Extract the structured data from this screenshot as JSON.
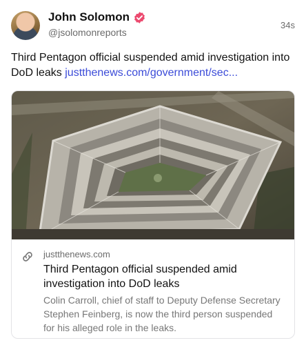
{
  "author": {
    "name": "John Solomon",
    "handle": "@jsolomonreports",
    "verified": true,
    "avatar_icon": "avatar-photo"
  },
  "post": {
    "time": "34s",
    "text": "Third Pentagon official suspended amid investigation into DoD leaks ",
    "link_text": "justthenews.com/government/sec..."
  },
  "card": {
    "image_icon": "pentagon-aerial-photo",
    "domain": "justthenews.com",
    "title": "Third Pentagon official suspended amid investigation into DoD leaks",
    "description": "Colin Carroll, chief of staff to Deputy Defense Secretary Stephen Feinberg, is now the third person suspended for his alleged role in the leaks.",
    "link_icon": "link-icon"
  },
  "colors": {
    "link": "#3b4bd8",
    "verified": "#ec4a6f",
    "muted": "#6b6b6b"
  }
}
